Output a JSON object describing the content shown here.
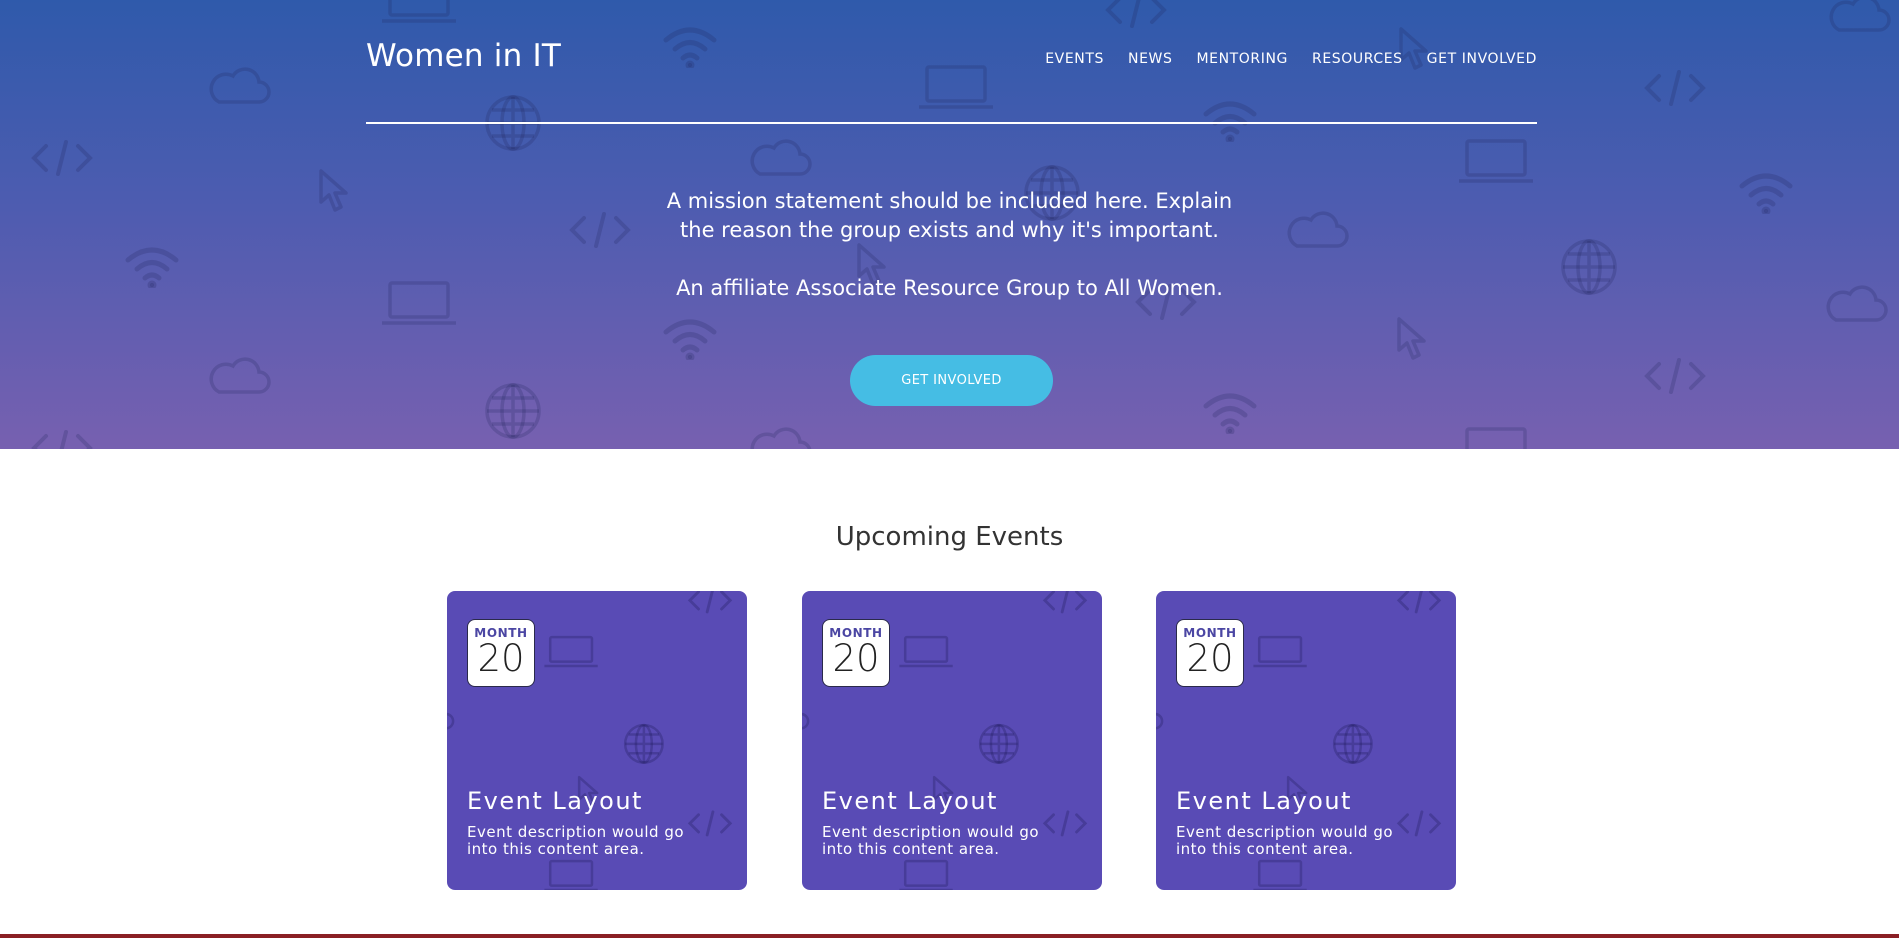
{
  "header": {
    "brand": "Women in IT",
    "nav": [
      "EVENTS",
      "NEWS",
      "MENTORING",
      "RESOURCES",
      "GET INVOLVED"
    ]
  },
  "hero": {
    "mission": "A mission statement should be included here. Explain the reason the group exists and why it's important.",
    "affiliate": "An affiliate Associate Resource Group to All Women.",
    "cta_label": "GET INVOLVED"
  },
  "events": {
    "title": "Upcoming Events",
    "cards": [
      {
        "month": "MONTH",
        "day": "20",
        "title": "Event Layout",
        "description": "Event description would go into this content area."
      },
      {
        "month": "MONTH",
        "day": "20",
        "title": "Event Layout",
        "description": "Event description would go into this content area."
      },
      {
        "month": "MONTH",
        "day": "20",
        "title": "Event Layout",
        "description": "Event description would go into this content area."
      }
    ]
  },
  "colors": {
    "hero_top": "#2f5aab",
    "hero_bottom": "#7760b0",
    "cta": "#45bde4",
    "card": "#594bb5",
    "date_month": "#4b46a3"
  }
}
